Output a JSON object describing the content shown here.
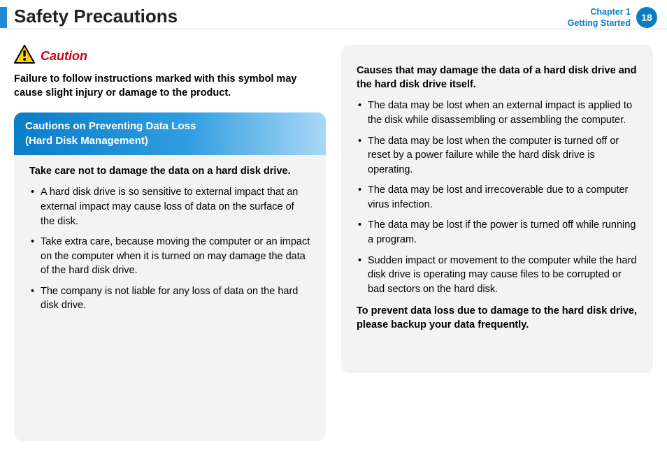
{
  "header": {
    "title": "Safety Precautions",
    "chapter_line1": "Chapter 1",
    "chapter_line2": "Getting Started",
    "page_number": "18"
  },
  "caution": {
    "label": "Caution",
    "body": "Failure to follow instructions marked with this symbol may cause slight injury or damage to the product."
  },
  "left_panel": {
    "header_line1": "Cautions on Preventing Data Loss",
    "header_line2": "(Hard Disk Management)",
    "subhead": "Take care not to damage the data on a hard disk drive.",
    "items": [
      "A hard disk drive is so sensitive to external impact that an external impact may cause loss of data on the surface of the disk.",
      "Take extra care, because moving the computer or an impact on the computer when it is turned on may damage the data of the hard disk drive.",
      "The company is not liable for any loss of data on the hard disk drive."
    ]
  },
  "right_panel": {
    "subhead": "Causes that may damage the data of a hard disk drive and the hard disk drive itself.",
    "items": [
      "The data may be lost when an external impact is applied to the disk while disassembling or assembling the computer.",
      "The data may be lost when the computer is turned off or reset by a power failure while the hard disk drive is operating.",
      "The data may be lost and irrecoverable due to a computer virus infection.",
      "The data may be lost if the power is turned off while running a program.",
      "Sudden impact or movement to the computer while the hard disk drive is operating may cause files to be corrupted or bad sectors on the hard disk."
    ],
    "closing": "To prevent data loss due to damage to the hard disk drive, please backup your data frequently."
  }
}
